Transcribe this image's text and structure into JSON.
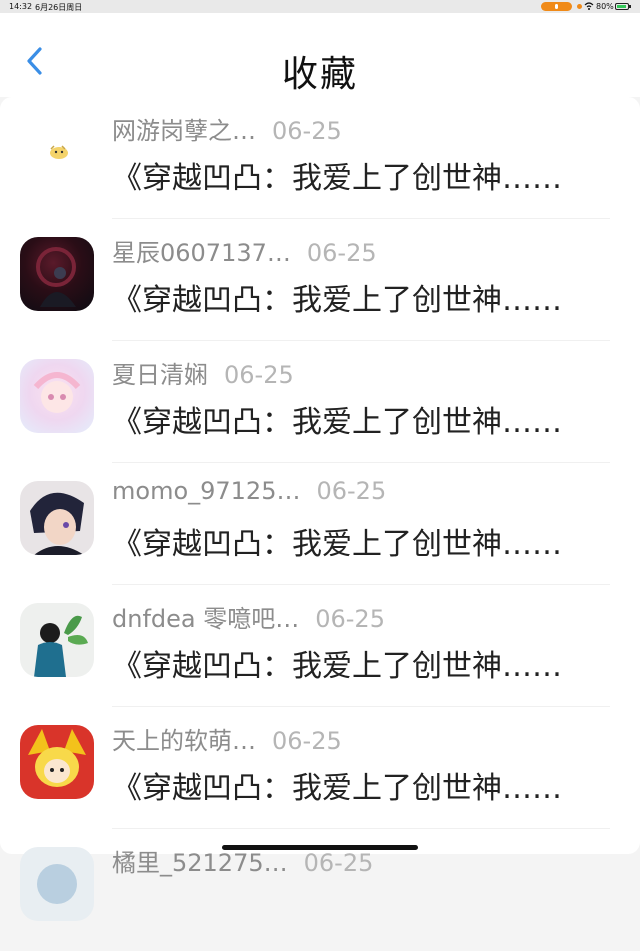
{
  "status_bar": {
    "time": "14:32",
    "date": "6月26日周日",
    "battery": "80%"
  },
  "header": {
    "title": "收藏",
    "back_icon": "chevron-left-icon"
  },
  "items": [
    {
      "name": "网游岗孽之…",
      "date": "06-25",
      "content": "《穿越凹凸：我爱上了创世神……"
    },
    {
      "name": "星辰0607137…",
      "date": "06-25",
      "content": "《穿越凹凸：我爱上了创世神……"
    },
    {
      "name": "夏日清娴",
      "date": "06-25",
      "content": "《穿越凹凸：我爱上了创世神……"
    },
    {
      "name": "momo_97125…",
      "date": "06-25",
      "content": "《穿越凹凸：我爱上了创世神……"
    },
    {
      "name": "dnfdea 零噫吧…",
      "date": "06-25",
      "content": "《穿越凹凸：我爱上了创世神……"
    },
    {
      "name": "天上的软萌…",
      "date": "06-25",
      "content": "《穿越凹凸：我爱上了创世神……"
    },
    {
      "name": "橘里_521275…",
      "date": "06-25",
      "content": ""
    }
  ],
  "colors": {
    "accent": "#3a8ee6",
    "name_text": "#8c8c8c",
    "date_text": "#b5b5b5"
  }
}
